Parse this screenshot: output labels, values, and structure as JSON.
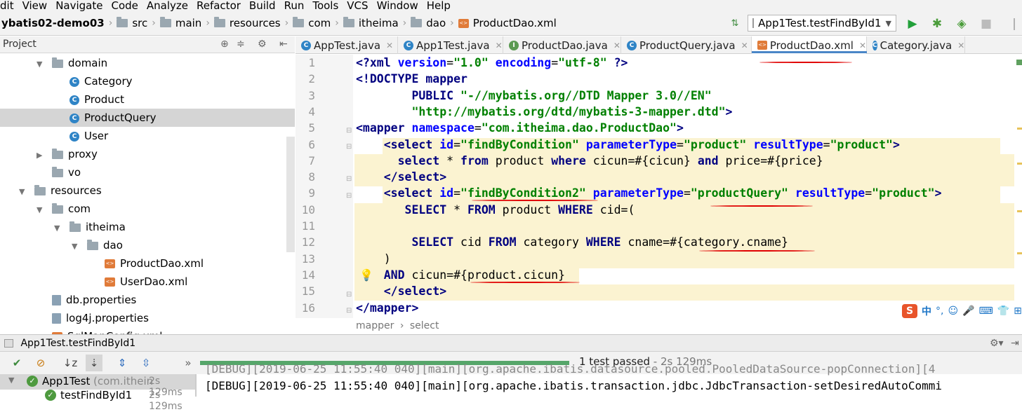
{
  "menu": [
    "dit",
    "View",
    "Navigate",
    "Code",
    "Analyze",
    "Refactor",
    "Build",
    "Run",
    "Tools",
    "VCS",
    "Window",
    "Help"
  ],
  "breadcrumb": [
    "ybatis02-demo03",
    "src",
    "main",
    "resources",
    "com",
    "itheima",
    "dao",
    "ProductDao.xml"
  ],
  "run_config": "App1Test.testFindById1",
  "project_panel": {
    "title": "Project"
  },
  "tabs": [
    "AppTest.java",
    "App1Test.java",
    "ProductDao.java",
    "ProductQuery.java",
    "ProductDao.xml",
    "Category.java"
  ],
  "active_tab": "ProductDao.xml",
  "tree": [
    {
      "label": "domain",
      "indent": 2,
      "type": "package",
      "arrow": "open"
    },
    {
      "label": "Category",
      "indent": 3,
      "type": "class"
    },
    {
      "label": "Product",
      "indent": 3,
      "type": "class"
    },
    {
      "label": "ProductQuery",
      "indent": 3,
      "type": "class",
      "selected": true
    },
    {
      "label": "User",
      "indent": 3,
      "type": "class"
    },
    {
      "label": "proxy",
      "indent": 2,
      "type": "package",
      "arrow": "closed"
    },
    {
      "label": "vo",
      "indent": 2,
      "type": "package"
    },
    {
      "label": "resources",
      "indent": 1,
      "type": "folder",
      "arrow": "open"
    },
    {
      "label": "com",
      "indent": 2,
      "type": "folder",
      "arrow": "open"
    },
    {
      "label": "itheima",
      "indent": 3,
      "type": "folder",
      "arrow": "open"
    },
    {
      "label": "dao",
      "indent": 4,
      "type": "folder",
      "arrow": "open"
    },
    {
      "label": "ProductDao.xml",
      "indent": 5,
      "type": "xml"
    },
    {
      "label": "UserDao.xml",
      "indent": 5,
      "type": "xml"
    },
    {
      "label": "db.properties",
      "indent": 2,
      "type": "props"
    },
    {
      "label": "log4j.properties",
      "indent": 2,
      "type": "props"
    },
    {
      "label": "SqlMapConfig.xml",
      "indent": 2,
      "type": "xml"
    }
  ],
  "line_numbers": [
    "1",
    "2",
    "3",
    "4",
    "5",
    "6",
    "7",
    "8",
    "9",
    "10",
    "11",
    "12",
    "13",
    "14",
    "15",
    "16"
  ],
  "code_lines": [
    "<?xml version=\"1.0\" encoding=\"utf-8\" ?>",
    "<!DOCTYPE mapper",
    "        PUBLIC \"-//mybatis.org//DTD Mapper 3.0//EN\"",
    "        \"http://mybatis.org/dtd/mybatis-3-mapper.dtd\">",
    "<mapper namespace=\"com.itheima.dao.ProductDao\">",
    "    <select id=\"findByCondition\" parameterType=\"product\" resultType=\"product\">",
    "      select * from product where cicun=#{cicun} and price=#{price}",
    "    </select>",
    "    <select id=\"findByCondition2\" parameterType=\"productQuery\" resultType=\"product\">",
    "       SELECT * FROM product WHERE cid=(",
    "",
    "        SELECT cid FROM category WHERE cname=#{category.cname}",
    "    )",
    "    AND cicun=#{product.cicun}",
    "    </select>",
    "</mapper>"
  ],
  "editor_breadcrumb": [
    "mapper",
    "select"
  ],
  "run_panel_title": "App1Test.testFindById1",
  "test_status": "1 test passed",
  "test_time": "- 2s 129ms",
  "test_tree": [
    {
      "label": "App1Test",
      "detail": "(com.ithein",
      "time": "2s 129ms"
    },
    {
      "label": "testFindById1",
      "detail": "",
      "time": "2s 129ms"
    }
  ],
  "console_lines": [
    "[DEBUG][2019-06-25 11:55:40 040][main][org.apache.ibatis.datasource.pooled.PooledDataSource-popConnection][4",
    "[DEBUG][2019-06-25 11:55:40 040][main][org.apache.ibatis.transaction.jdbc.JdbcTransaction-setDesiredAutoCommi"
  ],
  "ime_toolbar": {
    "label": "中"
  },
  "colors": {
    "keyword": "#000080",
    "string": "#008000",
    "highlight": "#fbf3d1",
    "annotation": "#e00000",
    "progress": "#56a66a"
  }
}
